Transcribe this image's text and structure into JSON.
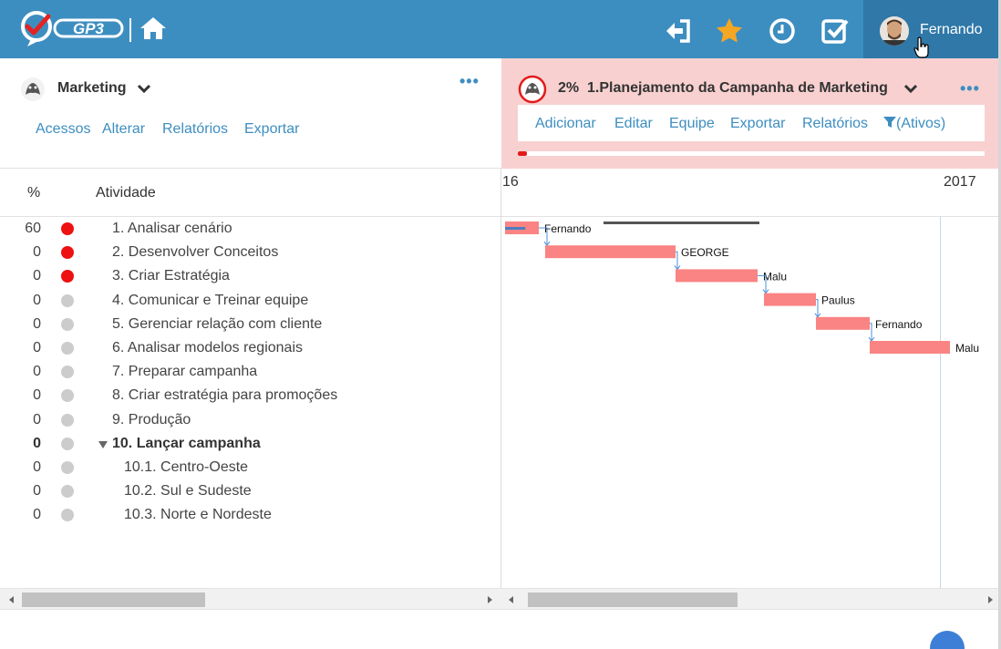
{
  "header": {
    "logo_text": "GP3",
    "user_name": "Fernando",
    "colors": {
      "bar": "#3d8ec0",
      "user_area": "#2f78a8",
      "star": "#f5a623"
    },
    "icons": [
      "logo-icon",
      "home-icon",
      "logout-icon",
      "star-icon",
      "clock-icon",
      "check-square-icon",
      "avatar",
      "hand-cursor-icon"
    ]
  },
  "left_panel": {
    "project_name": "Marketing",
    "more": "•••",
    "links": [
      "Acessos",
      "Alterar",
      "Relatórios",
      "Exportar"
    ]
  },
  "right_panel": {
    "percent": "2%",
    "title": "1.Planejamento da Campanha de Marketing",
    "more": "•••",
    "links": [
      "Adicionar",
      "Editar",
      "Equipe",
      "Exportar",
      "Relatórios"
    ],
    "filter_label": "(Ativos)",
    "progress": 0.02,
    "colors": {
      "background": "#f8d0d0",
      "progress": "#e41b1b"
    }
  },
  "grid": {
    "col_pct": "%",
    "col_activity": "Atividade",
    "rows": [
      {
        "pct": "60",
        "status": "red",
        "name": "1. Analisar cenário",
        "level": 0,
        "bold": false
      },
      {
        "pct": "0",
        "status": "red",
        "name": "2. Desenvolver Conceitos",
        "level": 0,
        "bold": false
      },
      {
        "pct": "0",
        "status": "red",
        "name": "3. Criar Estratégia",
        "level": 0,
        "bold": false
      },
      {
        "pct": "0",
        "status": "gray",
        "name": "4. Comunicar e Treinar equipe",
        "level": 0,
        "bold": false
      },
      {
        "pct": "0",
        "status": "gray",
        "name": "5. Gerenciar relação com cliente",
        "level": 0,
        "bold": false
      },
      {
        "pct": "0",
        "status": "gray",
        "name": "6. Analisar modelos regionais",
        "level": 0,
        "bold": false
      },
      {
        "pct": "0",
        "status": "gray",
        "name": "7. Preparar campanha",
        "level": 0,
        "bold": false
      },
      {
        "pct": "0",
        "status": "gray",
        "name": "8. Criar estratégia para promoções",
        "level": 0,
        "bold": false
      },
      {
        "pct": "0",
        "status": "gray",
        "name": "9. Produção",
        "level": 0,
        "bold": false
      },
      {
        "pct": "0",
        "status": "gray",
        "name": "10. Lançar campanha",
        "level": 0,
        "bold": true,
        "expanded": true
      },
      {
        "pct": "0",
        "status": "gray",
        "name": "10.1. Centro-Oeste",
        "level": 1,
        "bold": false
      },
      {
        "pct": "0",
        "status": "gray",
        "name": "10.2. Sul e Sudeste",
        "level": 1,
        "bold": false
      },
      {
        "pct": "0",
        "status": "gray",
        "name": "10.3. Norte e Nordeste",
        "level": 1,
        "bold": false
      }
    ],
    "status_colors": {
      "red": "#ee1111",
      "gray": "#cccccc"
    }
  },
  "gantt": {
    "year_labels": [
      "16",
      "2017"
    ],
    "bar_color": "#fa8383",
    "summary_color": "#555555",
    "progress_color": "#4a7fc1",
    "link_color": "#4a90d9",
    "tasks": [
      {
        "label": "Fernando",
        "progress": 0.6
      },
      {
        "label": "GEORGE",
        "progress": 0
      },
      {
        "label": "Malu",
        "progress": 0
      },
      {
        "label": "Paulus",
        "progress": 0
      },
      {
        "label": "Fernando",
        "progress": 0
      },
      {
        "label": "Malu",
        "progress": 0
      }
    ]
  }
}
